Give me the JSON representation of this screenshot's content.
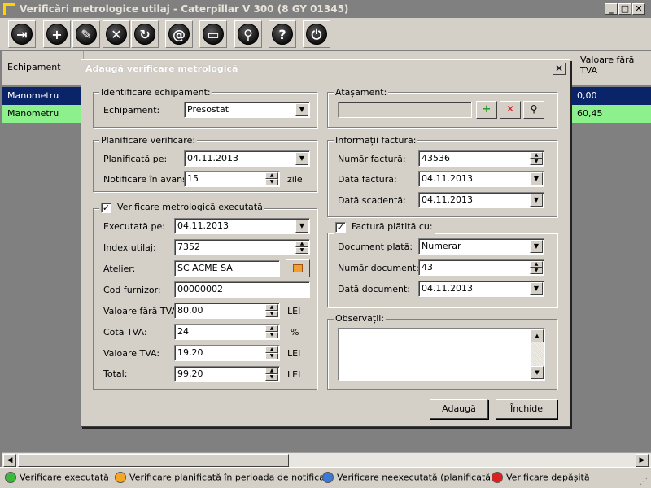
{
  "window": {
    "title": "Verificări metrologice utilaj - Caterpillar  V 300 (8 GY 01345)",
    "minimize": "_",
    "maximize": "□",
    "close": "✕"
  },
  "toolbar": {
    "buttons": [
      {
        "icon": "exit-icon",
        "glyph": "⇥"
      },
      {
        "icon": "add-icon",
        "glyph": "+"
      },
      {
        "icon": "edit-icon",
        "glyph": "✎"
      },
      {
        "icon": "delete-icon",
        "glyph": "✕"
      },
      {
        "icon": "refresh-icon",
        "glyph": "↻"
      },
      {
        "icon": "email-icon",
        "glyph": "@"
      },
      {
        "icon": "print-icon",
        "glyph": "▭"
      },
      {
        "icon": "search-icon",
        "glyph": "⚲"
      },
      {
        "icon": "help-icon",
        "glyph": "?"
      },
      {
        "icon": "power-icon",
        "glyph": "⏻"
      }
    ]
  },
  "grid": {
    "col_equipment": "Echipament",
    "col_value": "Valoare fără TVA",
    "rows": [
      {
        "equipment": "Manometru",
        "value": "0,00",
        "color": "#0a246a"
      },
      {
        "equipment": "Manometru",
        "value": "60,45",
        "color": "#8cf08c"
      }
    ]
  },
  "legend": [
    {
      "label": "Verificare executată",
      "color": "#3cb83c"
    },
    {
      "label": "Verificare planificată în perioada de notificare",
      "color": "#f5a623"
    },
    {
      "label": "Verificare neexecutată (planificată)",
      "color": "#3c78d8"
    },
    {
      "label": "Verificare depășită",
      "color": "#e02020"
    }
  ],
  "dialog": {
    "title": "Adaugă verificare metrologică",
    "close": "✕",
    "identify": {
      "title": "Identificare echipament:",
      "equipment_label": "Echipament:",
      "equipment_value": "Presostat"
    },
    "planning": {
      "title": "Planificare verificare:",
      "planned_label": "Planificată pe:",
      "planned_value": "04.11.2013",
      "notify_label": "Notificare în avans:",
      "notify_value": "15",
      "notify_unit": "zile"
    },
    "executed": {
      "title": "Verificare metrologică executată",
      "checked": true,
      "executed_label": "Executată pe:",
      "executed_value": "04.11.2013",
      "index_label": "Index utilaj:",
      "index_value": "7352",
      "workshop_label": "Atelier:",
      "workshop_value": "SC ACME SA",
      "supplier_label": "Cod furnizor:",
      "supplier_value": "00000002",
      "net_label": "Valoare fără TVA:",
      "net_value": "80,00",
      "net_unit": "LEI",
      "vat_rate_label": "Cotă TVA:",
      "vat_rate_value": "24",
      "vat_rate_unit": "%",
      "vat_label": "Valoare TVA:",
      "vat_value": "19,20",
      "vat_unit": "LEI",
      "total_label": "Total:",
      "total_value": "99,20",
      "total_unit": "LEI"
    },
    "attachment": {
      "title": "Atașament:",
      "value": ""
    },
    "invoice": {
      "title": "Informații factură:",
      "number_label": "Număr factură:",
      "number_value": "43536",
      "date_label": "Dată factură:",
      "date_value": "04.11.2013",
      "due_label": "Dată scadentă:",
      "due_value": "04.11.2013"
    },
    "paid": {
      "title": "Factură plătită cu:",
      "checked": true,
      "doc_label": "Document plată:",
      "doc_value": "Numerar",
      "docnum_label": "Număr document:",
      "docnum_value": "43",
      "docdate_label": "Dată document:",
      "docdate_value": "04.11.2013"
    },
    "notes": {
      "title": "Observații:",
      "value": ""
    },
    "add_button": "Adaugă",
    "close_button": "Închide"
  }
}
